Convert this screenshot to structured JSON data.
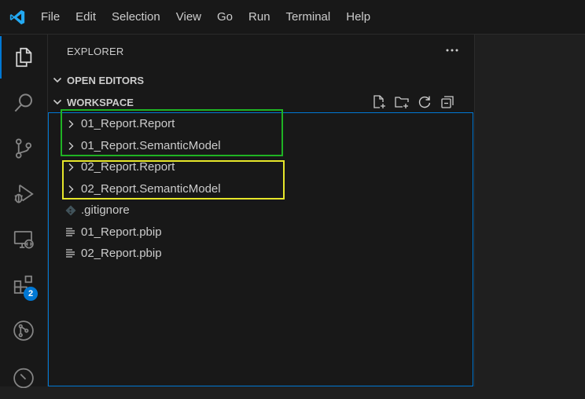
{
  "menu": {
    "items": [
      "File",
      "Edit",
      "Selection",
      "View",
      "Go",
      "Run",
      "Terminal",
      "Help"
    ]
  },
  "activity_bar": {
    "items": [
      {
        "icon": "files-icon",
        "active": true
      },
      {
        "icon": "search-icon",
        "active": false
      },
      {
        "icon": "source-control-icon",
        "active": false
      },
      {
        "icon": "run-debug-icon",
        "active": false
      },
      {
        "icon": "remote-explorer-icon",
        "active": false
      },
      {
        "icon": "extensions-icon",
        "active": false,
        "badge": "2"
      },
      {
        "icon": "git-graph-icon",
        "active": false
      },
      {
        "icon": "git-icon",
        "active": false
      }
    ]
  },
  "explorer": {
    "title": "EXPLORER",
    "open_editors_label": "OPEN EDITORS",
    "workspace_label": "WORKSPACE",
    "workspace_actions": [
      "new-file-icon",
      "new-folder-icon",
      "refresh-icon",
      "collapse-all-icon"
    ],
    "tree": [
      {
        "name": "01_Report.Report",
        "type": "folder"
      },
      {
        "name": "01_Report.SemanticModel",
        "type": "folder"
      },
      {
        "name": "02_Report.Report",
        "type": "folder"
      },
      {
        "name": "02_Report.SemanticModel",
        "type": "folder"
      },
      {
        "name": ".gitignore",
        "type": "gitignore"
      },
      {
        "name": "01_Report.pbip",
        "type": "file"
      },
      {
        "name": "02_Report.pbip",
        "type": "file"
      }
    ]
  },
  "colors": {
    "accent": "#0078d4",
    "highlight_green": "#1fb224",
    "highlight_yellow": "#e6e62a",
    "vscode_blue": "#23a9f2"
  }
}
